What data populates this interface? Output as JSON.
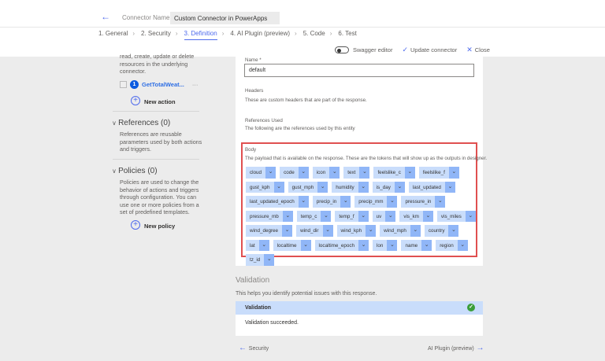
{
  "header": {
    "connector_name_label": "Connector Name",
    "connector_name_value": "Custom Connector in PowerApps"
  },
  "tabs": [
    {
      "label": "1. General"
    },
    {
      "label": "2. Security"
    },
    {
      "label": "3. Definition",
      "active": true
    },
    {
      "label": "4. AI Plugin (preview)"
    },
    {
      "label": "5. Code"
    },
    {
      "label": "6. Test"
    }
  ],
  "commands": {
    "swagger": "Swagger editor",
    "update": "Update connector",
    "close": "Close"
  },
  "sidebar": {
    "actions_desc": "read, create, update or delete resources in the underlying connector.",
    "action_number": "1",
    "action_name": "GetTotalWeat...",
    "more": "···",
    "new_action": "New action",
    "references_title": "References (0)",
    "references_desc": "References are reusable parameters used by both actions and triggers.",
    "policies_title": "Policies (0)",
    "policies_desc": "Policies are used to change the behavior of actions and triggers through configuration. You can use one or more policies from a set of predefined templates.",
    "new_policy": "New policy"
  },
  "response": {
    "name_label": "Name *",
    "name_value": "default",
    "headers_label": "Headers",
    "headers_desc": "These are custom headers that are part of the response.",
    "refs_label": "References Used",
    "refs_desc": "The following are the references used by this entity",
    "body_label": "Body",
    "body_desc": "The payload that is available on the response. These are the tokens that will show up as the outputs in designer.",
    "tokens": [
      "cloud",
      "code",
      "icon",
      "text",
      "feelslike_c",
      "feelslike_f",
      "gust_kph",
      "gust_mph",
      "humidity",
      "is_day",
      "last_updated",
      "last_updated_epoch",
      "precip_in",
      "precip_mm",
      "pressure_in",
      "pressure_mb",
      "temp_c",
      "temp_f",
      "uv",
      "vis_km",
      "vis_miles",
      "wind_degree",
      "wind_dir",
      "wind_kph",
      "wind_mph",
      "country",
      "lat",
      "localtime",
      "localtime_epoch",
      "lon",
      "name",
      "region",
      "tz_id"
    ]
  },
  "validation": {
    "title": "Validation",
    "desc": "This helps you identify potential issues with this response.",
    "header": "Validation",
    "result": "Validation succeeded.",
    "status_color": "#3a9e3a"
  },
  "nav": {
    "prev": "Security",
    "next": "AI Plugin (preview)"
  },
  "colors": {
    "accent": "#4f6bed",
    "highlight": "#e05050"
  }
}
